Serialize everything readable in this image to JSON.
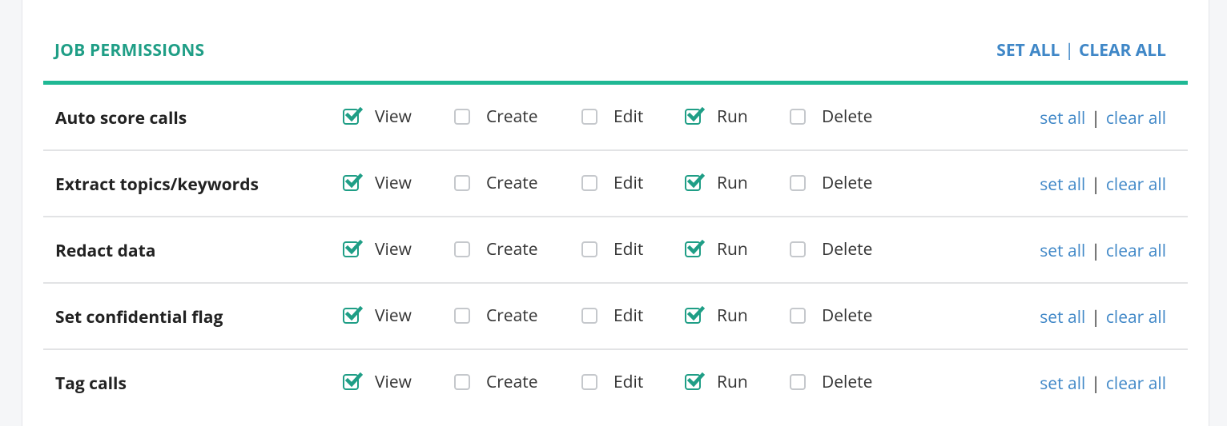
{
  "header": {
    "title": "JOB PERMISSIONS",
    "set_all": "SET ALL",
    "separator": "|",
    "clear_all": "CLEAR ALL"
  },
  "colors": {
    "accent": "#1f9e86",
    "bar": "#1fb894",
    "link": "#3f87c7"
  },
  "permission_columns": [
    "View",
    "Create",
    "Edit",
    "Run",
    "Delete"
  ],
  "rows": [
    {
      "label": "Auto score calls",
      "perms": [
        {
          "label": "View",
          "checked": true
        },
        {
          "label": "Create",
          "checked": false
        },
        {
          "label": "Edit",
          "checked": false
        },
        {
          "label": "Run",
          "checked": true
        },
        {
          "label": "Delete",
          "checked": false
        }
      ],
      "set_all": "set all",
      "separator": "|",
      "clear_all": "clear all"
    },
    {
      "label": "Extract topics/keywords",
      "perms": [
        {
          "label": "View",
          "checked": true
        },
        {
          "label": "Create",
          "checked": false
        },
        {
          "label": "Edit",
          "checked": false
        },
        {
          "label": "Run",
          "checked": true
        },
        {
          "label": "Delete",
          "checked": false
        }
      ],
      "set_all": "set all",
      "separator": "|",
      "clear_all": "clear all"
    },
    {
      "label": "Redact data",
      "perms": [
        {
          "label": "View",
          "checked": true
        },
        {
          "label": "Create",
          "checked": false
        },
        {
          "label": "Edit",
          "checked": false
        },
        {
          "label": "Run",
          "checked": true
        },
        {
          "label": "Delete",
          "checked": false
        }
      ],
      "set_all": "set all",
      "separator": "|",
      "clear_all": "clear all"
    },
    {
      "label": "Set confidential flag",
      "perms": [
        {
          "label": "View",
          "checked": true
        },
        {
          "label": "Create",
          "checked": false
        },
        {
          "label": "Edit",
          "checked": false
        },
        {
          "label": "Run",
          "checked": true
        },
        {
          "label": "Delete",
          "checked": false
        }
      ],
      "set_all": "set all",
      "separator": "|",
      "clear_all": "clear all"
    },
    {
      "label": "Tag calls",
      "perms": [
        {
          "label": "View",
          "checked": true
        },
        {
          "label": "Create",
          "checked": false
        },
        {
          "label": "Edit",
          "checked": false
        },
        {
          "label": "Run",
          "checked": true
        },
        {
          "label": "Delete",
          "checked": false
        }
      ],
      "set_all": "set all",
      "separator": "|",
      "clear_all": "clear all"
    }
  ]
}
